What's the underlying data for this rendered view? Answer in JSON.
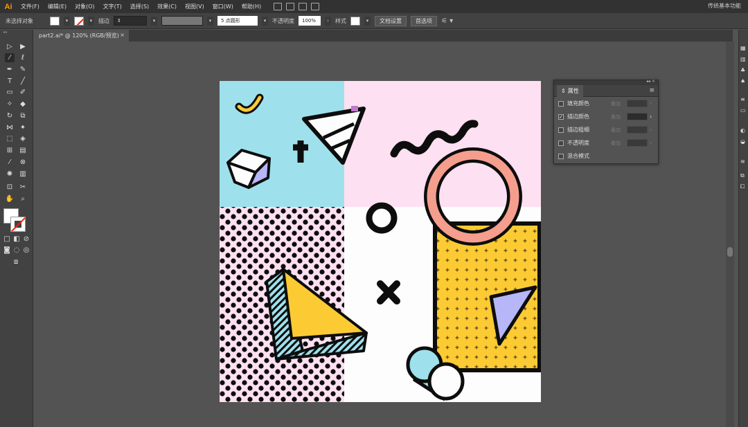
{
  "app": {
    "logo": "Ai",
    "workspace": "传统基本功能"
  },
  "menu": [
    "文件(F)",
    "编辑(E)",
    "对象(O)",
    "文字(T)",
    "选择(S)",
    "效果(C)",
    "视图(V)",
    "窗口(W)",
    "帮助(H)"
  ],
  "control": {
    "selection_label": "未选择对象",
    "stroke_label": "描边",
    "brush_value": "5 点圆形",
    "opacity_label": "不透明度",
    "opacity_value": "100%",
    "style_label": "样式",
    "doc_settings": "文档设置",
    "preferences": "首选项"
  },
  "document": {
    "tab_title": "part2.ai* @ 120% (RGB/预览)",
    "close": "×"
  },
  "attributes_panel": {
    "title": "属性",
    "rows": [
      {
        "label": "填充颜色",
        "checked": false,
        "sub": "叠加",
        "value": "",
        "enabled": false
      },
      {
        "label": "描边颜色",
        "checked": true,
        "sub": "叠加",
        "value": "",
        "enabled": true
      },
      {
        "label": "描边粗细",
        "checked": false,
        "sub": "叠加",
        "value": "",
        "enabled": false
      },
      {
        "label": "不透明度",
        "checked": false,
        "sub": "叠加",
        "value": "",
        "enabled": false
      },
      {
        "label": "混合模式",
        "checked": false,
        "sub": "",
        "value": "",
        "enabled": false
      }
    ]
  },
  "colors": {
    "artboard_blue": "#9ee1ec",
    "artboard_pink": "#fde0f1",
    "shape_yellow": "#fccb33",
    "shape_salmon": "#f59e8e",
    "shape_lavender": "#b6b6f8",
    "outline": "#0d0d0d"
  }
}
